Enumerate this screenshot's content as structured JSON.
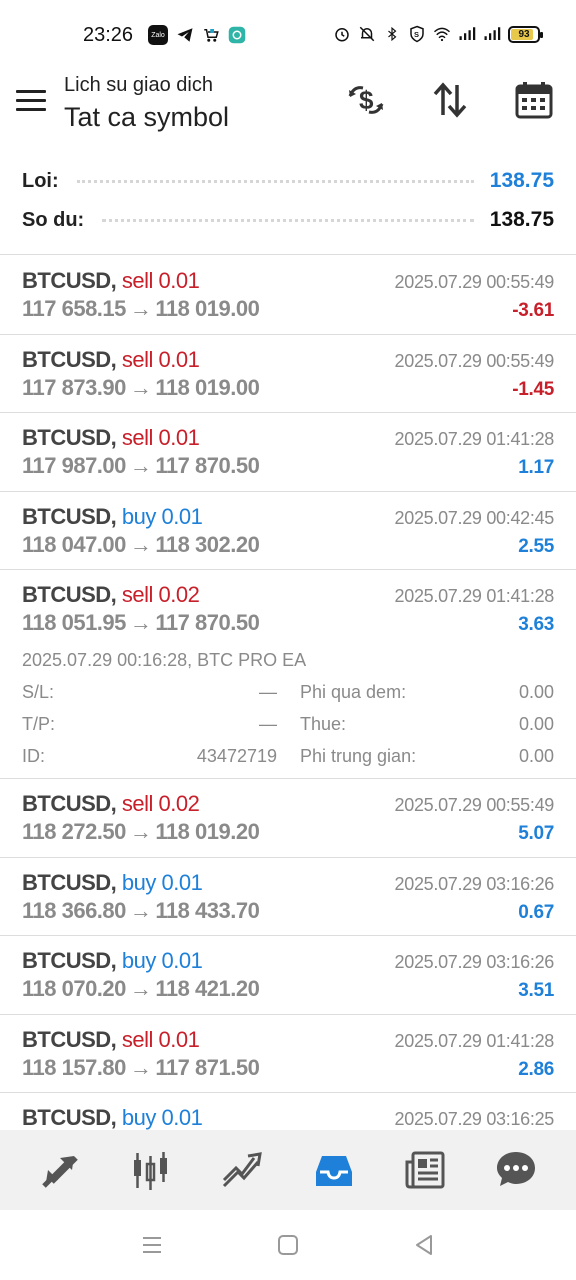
{
  "status_bar": {
    "time": "23:26",
    "apps": [
      "Zalo",
      "telegram-icon",
      "shop-icon",
      "app-icon"
    ],
    "battery": "93"
  },
  "header": {
    "subtitle": "Lich su giao dich",
    "title": "Tat ca symbol",
    "icons": [
      "currency-exchange-icon",
      "sort-icon",
      "calendar-icon"
    ]
  },
  "summary": {
    "profit_label": "Loi:",
    "profit_value": "138.75",
    "balance_label": "So du:",
    "balance_value": "138.75",
    "accent_color": "#1e80d8"
  },
  "trades": [
    {
      "symbol": "BTCUSD,",
      "side": "sell 0.01",
      "time": "2025.07.29 00:55:49",
      "open": "117 658.15",
      "close": "118 019.00",
      "profit": "-3.61"
    },
    {
      "symbol": "BTCUSD,",
      "side": "sell 0.01",
      "time": "2025.07.29 00:55:49",
      "open": "117 873.90",
      "close": "118 019.00",
      "profit": "-1.45"
    },
    {
      "symbol": "BTCUSD,",
      "side": "sell 0.01",
      "time": "2025.07.29 01:41:28",
      "open": "117 987.00",
      "close": "117 870.50",
      "profit": "1.17"
    },
    {
      "symbol": "BTCUSD,",
      "side": "buy 0.01",
      "time": "2025.07.29 00:42:45",
      "open": "118 047.00",
      "close": "118 302.20",
      "profit": "2.55"
    },
    {
      "symbol": "BTCUSD,",
      "side": "sell 0.02",
      "time": "2025.07.29 01:41:28",
      "open": "118 051.95",
      "close": "117 870.50",
      "profit": "3.63",
      "details": {
        "comment": "2025.07.29 00:16:28, BTC PRO EA",
        "sl_label": "S/L:",
        "sl_value": "—",
        "tp_label": "T/P:",
        "tp_value": "—",
        "id_label": "ID:",
        "id_value": "43472719",
        "swap_label": "Phi qua dem:",
        "swap_value": "0.00",
        "tax_label": "Thue:",
        "tax_value": "0.00",
        "commission_label": "Phi trung gian:",
        "commission_value": "0.00"
      }
    },
    {
      "symbol": "BTCUSD,",
      "side": "sell 0.02",
      "time": "2025.07.29 00:55:49",
      "open": "118 272.50",
      "close": "118 019.20",
      "profit": "5.07"
    },
    {
      "symbol": "BTCUSD,",
      "side": "buy 0.01",
      "time": "2025.07.29 03:16:26",
      "open": "118 366.80",
      "close": "118 433.70",
      "profit": "0.67"
    },
    {
      "symbol": "BTCUSD,",
      "side": "buy 0.01",
      "time": "2025.07.29 03:16:26",
      "open": "118 070.20",
      "close": "118 421.20",
      "profit": "3.51"
    },
    {
      "symbol": "BTCUSD,",
      "side": "sell 0.01",
      "time": "2025.07.29 01:41:28",
      "open": "118 157.80",
      "close": "117 871.50",
      "profit": "2.86"
    },
    {
      "symbol": "BTCUSD,",
      "side": "buy 0.01",
      "time": "2025.07.29 03:16:25",
      "open": "",
      "close": "",
      "profit": ""
    }
  ],
  "arrow": "→",
  "bottom_nav": [
    "quotes-icon",
    "chart-icon",
    "trade-icon",
    "history-icon",
    "news-icon",
    "chat-icon"
  ],
  "colors": {
    "sell": "#c8202b",
    "buy": "#1e80d8",
    "active_nav": "#1e80d8"
  }
}
